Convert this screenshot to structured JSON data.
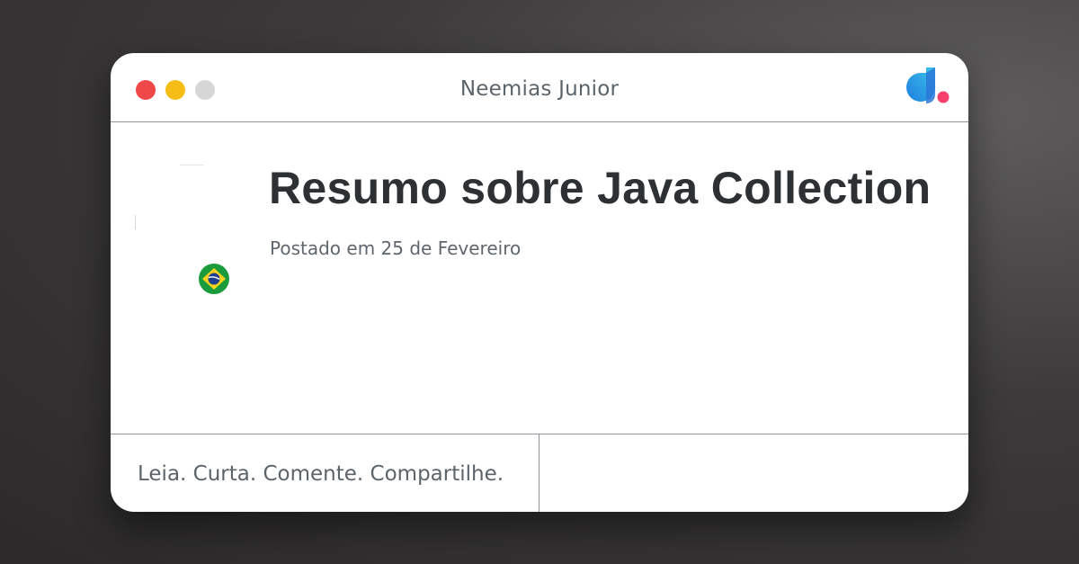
{
  "window": {
    "title": "Neemias Junior",
    "controls": [
      {
        "name": "close",
        "color": "#f04848"
      },
      {
        "name": "minimize",
        "color": "#f6bd17"
      },
      {
        "name": "maximize",
        "color": "#d6d6d6"
      }
    ]
  },
  "logo": {
    "icon": "dio-logo-icon",
    "colors": {
      "primary": "#1d7fe0",
      "secondary": "#3fc2e8",
      "accent": "#f5416c"
    }
  },
  "post": {
    "title": "Resumo sobre Java Collection",
    "date": "Postado em 25 de Fevereiro",
    "avatar_icon": "author-avatar",
    "flag_icon": "brazil-flag-icon"
  },
  "footer": {
    "tagline": "Leia. Curta. Comente. Compartilhe."
  },
  "colors": {
    "divider": "#8f959a",
    "title_text": "#2e3134",
    "muted_text": "#5c646b"
  }
}
